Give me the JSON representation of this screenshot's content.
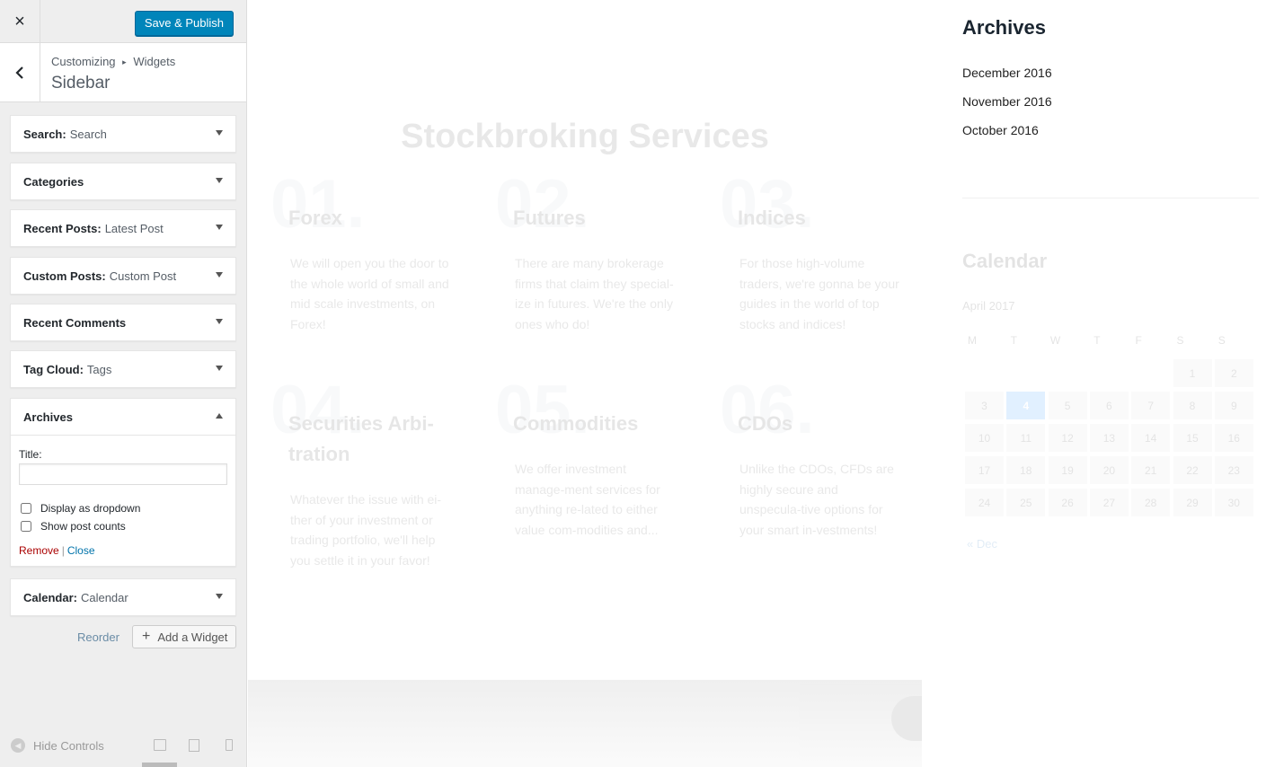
{
  "topbar": {
    "close_icon": "×",
    "publish_label": "Save & Publish"
  },
  "section": {
    "crumb_root": "Customizing",
    "crumb_sep": "▸",
    "crumb_leaf": "Widgets",
    "title": "Sidebar"
  },
  "widgets": [
    {
      "name": "Search:",
      "sub": "Search"
    },
    {
      "name": "Categories",
      "sub": ""
    },
    {
      "name": "Recent Posts:",
      "sub": "Latest Post"
    },
    {
      "name": "Custom Posts:",
      "sub": "Custom Post"
    },
    {
      "name": "Recent Comments",
      "sub": ""
    },
    {
      "name": "Tag Cloud:",
      "sub": "Tags"
    },
    {
      "name": "Archives",
      "sub": ""
    },
    {
      "name": "Calendar:",
      "sub": "Calendar"
    }
  ],
  "archives_form": {
    "title_label": "Title:",
    "title_value": "",
    "dropdown_label": "Display as dropdown",
    "counts_label": "Show post counts",
    "remove_label": "Remove",
    "separator": "|",
    "close_label": "Close"
  },
  "actions": {
    "reorder_label": "Reorder",
    "add_plus": "+",
    "add_label": "Add a Widget"
  },
  "footer": {
    "hide_label": "Hide Controls"
  },
  "preview": {
    "title": "Stockbroking Services",
    "services": [
      {
        "num": "01.",
        "title": "Forex",
        "text": "We will open you the door to the whole world of small and mid scale investments, on Forex!"
      },
      {
        "num": "02.",
        "title": "Futures",
        "text": "There are many brokerage firms that claim they special-ize in futures. We're the only ones who do!"
      },
      {
        "num": "03.",
        "title": "Indices",
        "text": "For those high-volume traders, we're gonna be your guides in the world of top stocks and indices!"
      },
      {
        "num": "04.",
        "title": "Securities Arbi-tration",
        "text": "Whatever the issue with ei-ther of your investment or trading portfolio, we'll help you settle it in your favor!"
      },
      {
        "num": "05.",
        "title": "Commodities",
        "text": "We offer investment manage-ment services for anything re-lated to either value com-modities and..."
      },
      {
        "num": "06.",
        "title": "CDOs",
        "text": "Unlike the CDOs, CFDs are highly secure and unspecula-tive options for your smart in-vestments!"
      }
    ]
  },
  "sidebar_preview": {
    "archives_title": "Archives",
    "archives": [
      "December 2016",
      "November 2016",
      "October 2016"
    ],
    "calendar_title": "Calendar",
    "month": "April 2017",
    "weekdays": [
      "M",
      "T",
      "W",
      "T",
      "F",
      "S",
      "S"
    ],
    "today": "4",
    "prev_link": "« Dec"
  }
}
